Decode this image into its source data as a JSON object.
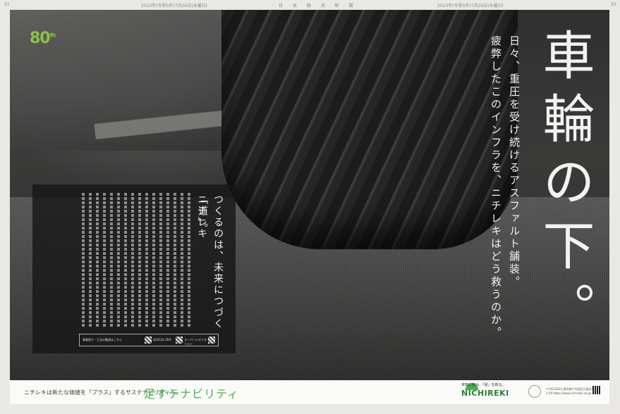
{
  "header": {
    "page_left": "21",
    "page_right": "20",
    "paper_name": "日 本 経 済 新 聞",
    "date_left": "2023年(令和5年)7月26日(水曜日)",
    "date_right": "2023年(令和5年)7月26日(水曜日)"
  },
  "logo80": {
    "number": "80",
    "suffix": "th"
  },
  "headline": "車輪の下。",
  "subcopy": {
    "line1": "日々、重圧を受け続けるアスファルト舗装。",
    "line2": "疲弊したこのインフラを、ニチレキはどう救うのか。"
  },
  "textbox": {
    "title_line1": "つくるのは、未来につづく「道」。",
    "title_line2": "ニチレキ",
    "qr_labels": [
      "事業紹介・工法の動画はこちら",
      "GLOCAL ERD",
      "スーパーシスウス アスファルト",
      "スタビライズト MC工法"
    ]
  },
  "footer": {
    "tagline": "ニチレキは新たな価値を「プラス」するサステナビリティへ。",
    "brand": "足すテナビリティ",
    "company_tag": "未知に挑み、「道」を創る。",
    "company_logo": "NICHIREKI",
    "address": "〒102-8222 東京都千代田区九段北4-3-29 https://www.nichireki.co.jp/"
  },
  "colors": {
    "brand_green": "#4caf50",
    "text_light": "#f2f2f0",
    "background": "#2f302f"
  }
}
